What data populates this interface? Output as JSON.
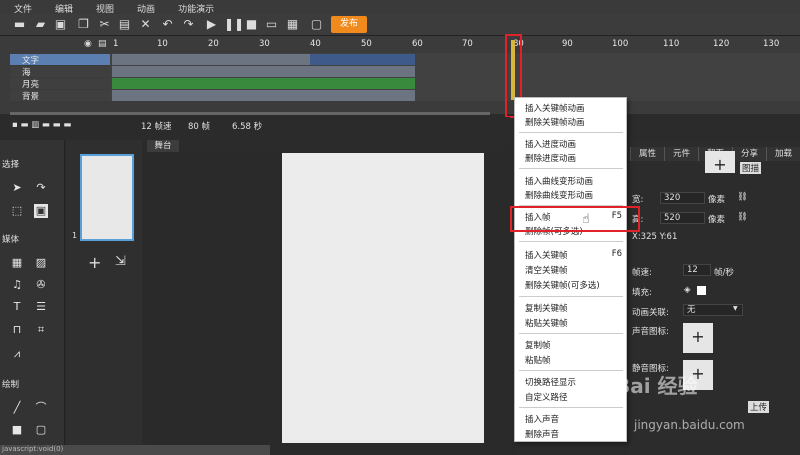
{
  "menu": [
    "文件",
    "编辑",
    "视图",
    "动画",
    "功能演示"
  ],
  "toolbar": {
    "publish": "发布"
  },
  "ruler": [
    "1",
    "10",
    "20",
    "30",
    "40",
    "50",
    "60",
    "70",
    "80",
    "90",
    "100",
    "110",
    "120",
    "130"
  ],
  "layers": [
    "文字",
    "海",
    "月亮",
    "背景"
  ],
  "timeline_footer": {
    "fps": "12 帧速",
    "frames": "80 帧",
    "duration": "6.58 秒"
  },
  "left_panel": {
    "select": "选择",
    "media": "媒体",
    "draw": "绘制"
  },
  "frame_number": "1",
  "stage_tab": "舞台",
  "tabs": [
    "属性",
    "元件",
    "翻页",
    "分享",
    "加载"
  ],
  "props": {
    "width_label": "宽:",
    "width": "320",
    "height_label": "高:",
    "height": "520",
    "unit": "像素",
    "coords": "X:325     Y:61",
    "speed_label": "帧速:",
    "speed": "12",
    "speed_unit": "帧/秒",
    "fill_label": "填充:",
    "anim_label": "动画关联:",
    "anim_value": "无",
    "sound_label": "声音图标:",
    "mute_label": "静音图标:",
    "upload": "上传",
    "img_label": "图描"
  },
  "context_menu": [
    {
      "label": "插入关键帧动画",
      "key": ""
    },
    {
      "label": "删除关键帧动画",
      "key": ""
    },
    {
      "label": "插入进度动画",
      "key": ""
    },
    {
      "label": "删除进度动画",
      "key": ""
    },
    {
      "label": "插入曲线变形动画",
      "key": ""
    },
    {
      "label": "删除曲线变形动画",
      "key": ""
    },
    {
      "label": "插入帧",
      "key": "F5"
    },
    {
      "label": "删除帧(可多选)",
      "key": ""
    },
    {
      "label": "插入关键帧",
      "key": "F6"
    },
    {
      "label": "清空关键帧",
      "key": ""
    },
    {
      "label": "删除关键帧(可多选)",
      "key": ""
    },
    {
      "label": "复制关键帧",
      "key": ""
    },
    {
      "label": "粘贴关键帧",
      "key": ""
    },
    {
      "label": "复制帧",
      "key": ""
    },
    {
      "label": "粘贴帧",
      "key": ""
    },
    {
      "label": "切换路径显示",
      "key": ""
    },
    {
      "label": "自定义路径",
      "key": ""
    },
    {
      "label": "插入声音",
      "key": ""
    },
    {
      "label": "删除声音",
      "key": ""
    }
  ],
  "watermark": {
    "text": "Bai 经验",
    "url": "jingyan.baidu.com"
  },
  "status": "javascript:void(0)"
}
